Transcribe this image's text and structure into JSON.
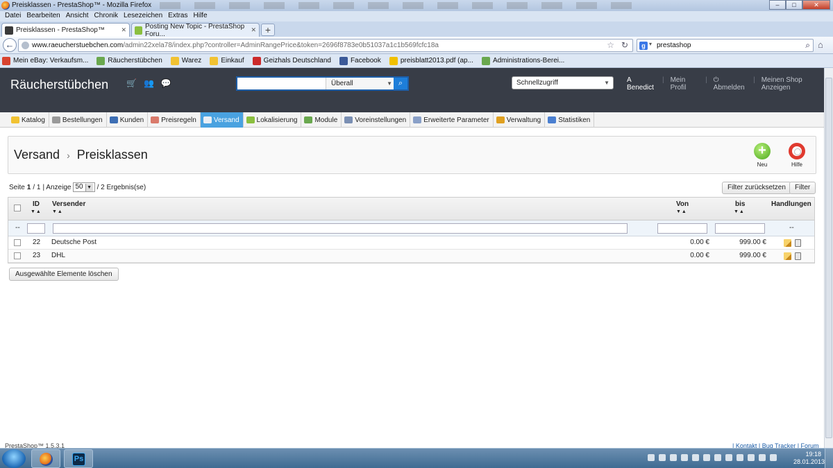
{
  "browser": {
    "window_title": "Preisklassen - PrestaShop™ - Mozilla Firefox",
    "menu": [
      "Datei",
      "Bearbeiten",
      "Ansicht",
      "Chronik",
      "Lesezeichen",
      "Extras",
      "Hilfe"
    ],
    "tabs": [
      {
        "label": "Preisklassen - PrestaShop™",
        "active": true
      },
      {
        "label": "Posting New Topic - PrestaShop Foru...",
        "active": false
      }
    ],
    "url_domain": "www.raeucherstuebchen.com",
    "url_path": "/admin22xela78/index.php?controller=AdminRangePrice&token=2696f8783e0b51037a1c1b569fcfc18a",
    "search_value": "prestashop",
    "bookmarks": [
      {
        "label": "Mein eBay: Verkaufsm...",
        "color": "#d9432f"
      },
      {
        "label": "Räucherstübchen",
        "color": "#6aa84f"
      },
      {
        "label": "Warez",
        "color": "#f1c232"
      },
      {
        "label": "Einkauf",
        "color": "#f1c232"
      },
      {
        "label": "Geizhals Deutschland",
        "color": "#cc2a2a"
      },
      {
        "label": "Facebook",
        "color": "#3b5998"
      },
      {
        "label": "preisblatt2013.pdf (ap...",
        "color": "#f0c000"
      },
      {
        "label": "Administrations-Berei...",
        "color": "#6aa84f"
      }
    ]
  },
  "header": {
    "shop_name": "Räucherstübchen",
    "search_scope": "Überall",
    "quick_access": "Schnellzugriff",
    "user_name": "A Benedict",
    "profile_link": "Mein Profil",
    "logout_link": "Abmelden",
    "view_shop_link": "Meinen Shop Anzeigen"
  },
  "nav_tabs": [
    {
      "label": "Katalog",
      "color": "#f1c232"
    },
    {
      "label": "Bestellungen",
      "color": "#999999"
    },
    {
      "label": "Kunden",
      "color": "#3d6eb4"
    },
    {
      "label": "Preisregeln",
      "color": "#d97a6b"
    },
    {
      "label": "Versand",
      "color": "#ffffff",
      "active": true
    },
    {
      "label": "Lokalisierung",
      "color": "#8bbf3f"
    },
    {
      "label": "Module",
      "color": "#6aa84f"
    },
    {
      "label": "Voreinstellungen",
      "color": "#7a8fb3"
    },
    {
      "label": "Erweiterte Parameter",
      "color": "#8aa0c8"
    },
    {
      "label": "Verwaltung",
      "color": "#e0a020"
    },
    {
      "label": "Statistiken",
      "color": "#4a7fd0"
    }
  ],
  "page": {
    "breadcrumb_parent": "Versand",
    "breadcrumb_current": "Preisklassen",
    "new_label": "Neu",
    "help_label": "Hilfe"
  },
  "list": {
    "page_prefix": "Seite",
    "page_current": "1",
    "page_total": "/ 1",
    "display_label": "| Anzeige",
    "per_page": "50",
    "results": "/ 2 Ergebnis(se)",
    "reset_filter": "Filter zurücksetzen",
    "filter": "Filter",
    "columns": {
      "id": "ID",
      "carrier": "Versender",
      "from": "Von",
      "to": "bis",
      "actions": "Handlungen"
    },
    "filter_dash": "--",
    "rows": [
      {
        "id": "22",
        "carrier": "Deutsche Post",
        "from": "0.00 €",
        "to": "999.00 €"
      },
      {
        "id": "23",
        "carrier": "DHL",
        "from": "0.00 €",
        "to": "999.00 €"
      }
    ],
    "bulk_delete": "Ausgewählte Elemente löschen"
  },
  "footer": {
    "version": "PrestaShop™ 1.5.3.1",
    "links": "| Kontakt | Bug Tracker | Forum"
  },
  "taskbar": {
    "time": "19:18",
    "date": "28.01.2013"
  }
}
